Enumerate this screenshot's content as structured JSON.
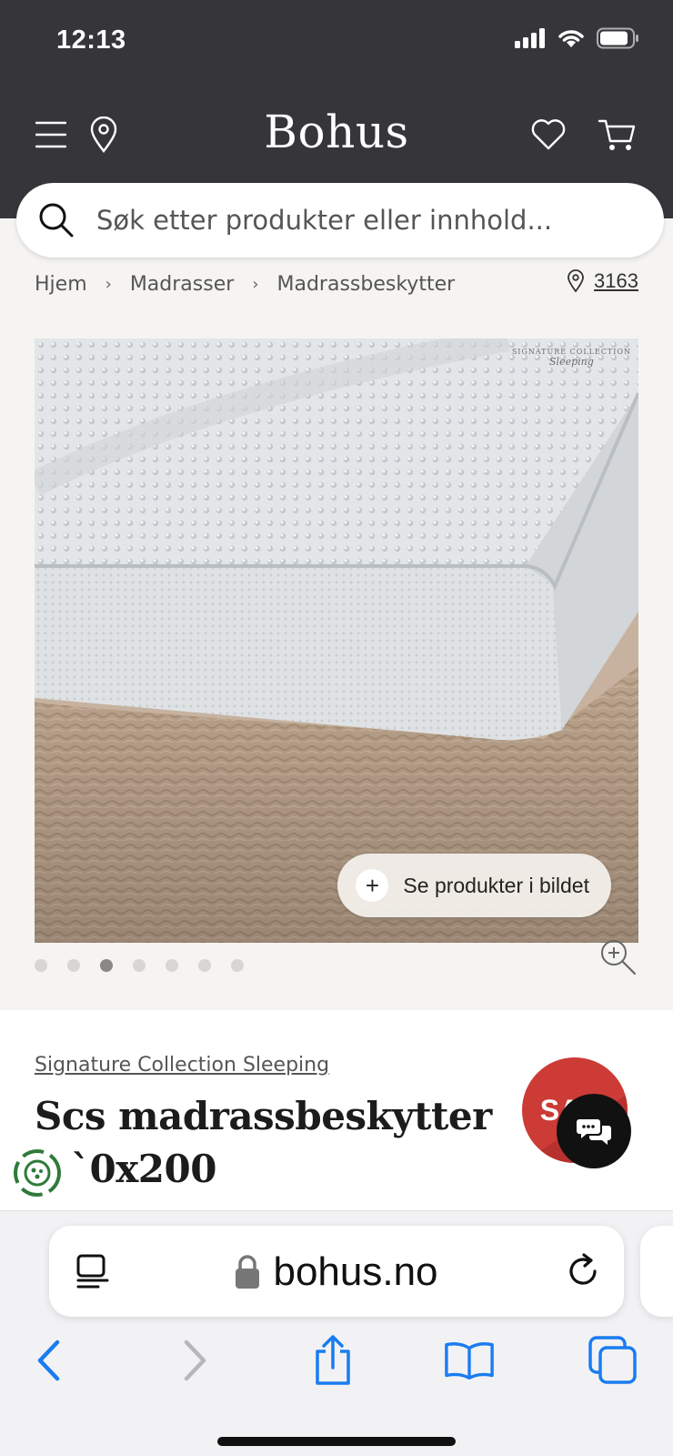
{
  "status_bar": {
    "time": "12:13"
  },
  "header": {
    "logo": "Bohus"
  },
  "search": {
    "placeholder": "Søk etter produkter eller innhold..."
  },
  "breadcrumb": {
    "items": [
      "Hjem",
      "Madrasser",
      "Madrassbeskytter"
    ],
    "store_number": "3163"
  },
  "gallery": {
    "brand_mark_line1": "SIGNATURE COLLECTION",
    "brand_mark_line2": "Sleeping",
    "see_products_label": "Se produkter i bildet",
    "total_images": 7,
    "active_index": 2
  },
  "product": {
    "brand": "Signature Collection Sleeping",
    "title_line1": "Scs madrassbeskytter",
    "title_line2": "`0x200",
    "badge": "SA"
  },
  "browser": {
    "url": "bohus.no"
  },
  "icons": [
    "menu-icon",
    "location-pin-icon",
    "heart-icon",
    "cart-icon",
    "search-icon",
    "zoom-in-icon",
    "chat-icon",
    "eco-icon",
    "reader-icon",
    "lock-icon",
    "reload-icon",
    "back-icon",
    "forward-icon",
    "share-icon",
    "bookmarks-icon",
    "tabs-icon"
  ],
  "colors": {
    "header_bg": "#36363a",
    "sale_red": "#cc3b36",
    "ios_blue": "#1a7cf0"
  }
}
